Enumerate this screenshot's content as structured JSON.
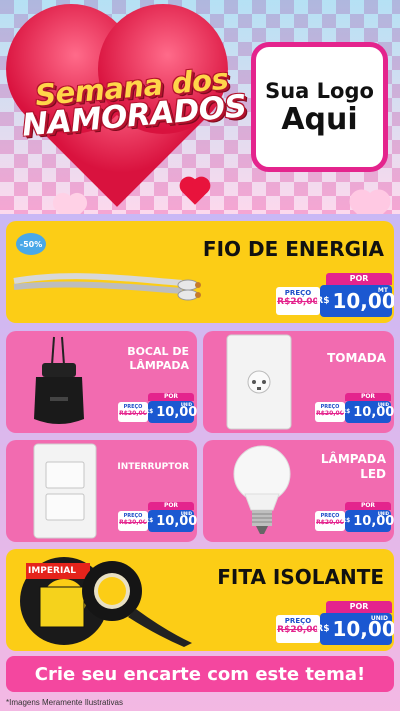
{
  "header": {
    "title_line1": "Semana dos",
    "title_line2": "NAMORADOS",
    "logo_line1": "Sua Logo",
    "logo_line2": "Aqui"
  },
  "products": [
    {
      "name": "FIO DE ENERGIA",
      "discount": "-50%",
      "por": "POR",
      "preco": "PREÇO",
      "old": "R$20,00",
      "currency": "R$",
      "price": "10,00",
      "unit": "MT"
    },
    {
      "name": "BOCAL DE LÂMPADA",
      "por": "POR",
      "preco": "PREÇO",
      "old": "R$20,00",
      "currency": "R$",
      "price": "10,00",
      "unit": "UNID"
    },
    {
      "name": "TOMADA",
      "por": "POR",
      "preco": "PREÇO",
      "old": "R$20,00",
      "currency": "R$",
      "price": "10,00",
      "unit": "UNID"
    },
    {
      "name": "INTERRUPTOR",
      "por": "POR",
      "preco": "PREÇO",
      "old": "R$20,00",
      "currency": "R$",
      "price": "10,00",
      "unit": "UNID"
    },
    {
      "name": "LÂMPADA LED",
      "por": "POR",
      "preco": "PREÇO",
      "old": "R$20,00",
      "currency": "R$",
      "price": "10,00",
      "unit": "UNID"
    },
    {
      "name": "FITA ISOLANTE",
      "por": "POR",
      "preco": "PREÇO",
      "old": "R$20,00",
      "currency": "R$",
      "price": "10,00",
      "unit": "UNID"
    }
  ],
  "tape_brand": "IMPERIAL",
  "footer": {
    "cta": "Crie seu encarte com este tema!",
    "note": "*Imagens Meramente Ilustrativas"
  },
  "colors": {
    "yellow": "#fccd16",
    "pink": "#f26bb0",
    "magenta": "#e4248d",
    "blue": "#1b58d1"
  }
}
